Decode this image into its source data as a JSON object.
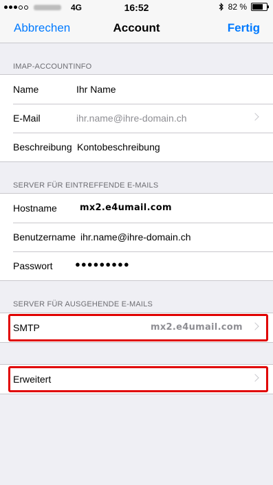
{
  "status": {
    "network": "4G",
    "time": "16:52",
    "battery": "82 %",
    "battery_level": 0.82
  },
  "nav": {
    "cancel": "Abbrechen",
    "title": "Account",
    "done": "Fertig"
  },
  "imap": {
    "header": "IMAP-ACCOUNTINFO",
    "name_label": "Name",
    "name_value": "Ihr Name",
    "email_label": "E-Mail",
    "email_value": "ihr.name@ihre-domain.ch",
    "desc_label": "Beschreibung",
    "desc_value": "Kontobeschreibung"
  },
  "incoming": {
    "header": "SERVER FÜR EINTREFFENDE E-MAILS",
    "host_label": "Hostname",
    "host_value": "mx2.e4umail.com",
    "user_label": "Benutzername",
    "user_value": "ihr.name@ihre-domain.ch",
    "pass_label": "Passwort",
    "pass_value": "●●●●●●●●●"
  },
  "outgoing": {
    "header": "SERVER FÜR AUSGEHENDE E-MAILS",
    "smtp_label": "SMTP",
    "smtp_value": "mx2.e4umail.com"
  },
  "advanced": {
    "label": "Erweitert"
  },
  "colors": {
    "accent": "#007aff",
    "highlight": "#e00000",
    "background": "#efeff4"
  }
}
